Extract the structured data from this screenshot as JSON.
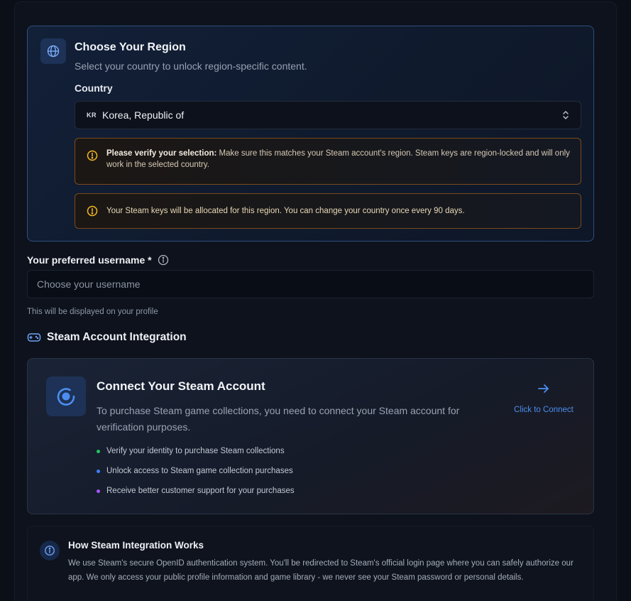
{
  "region": {
    "title": "Choose Your Region",
    "subtitle": "Select your country to unlock region-specific content.",
    "country_label": "Country",
    "selected_country_code": "KR",
    "selected_country_name": "Korea, Republic of",
    "warning_bold": "Please verify your selection:",
    "warning_text": " Make sure this matches your Steam account's region. Steam keys are region-locked and will only work in the selected country.",
    "notice_text": "Your Steam keys will be allocated for this region. You can change your country once every 90 days."
  },
  "username": {
    "label": "Your preferred username *",
    "placeholder": "Choose your username",
    "value": "",
    "help": "This will be displayed on your profile"
  },
  "steam": {
    "section_title": "Steam Account Integration",
    "connect_title": "Connect Your Steam Account",
    "connect_desc": "To purchase Steam game collections, you need to connect your Steam account for verification purposes.",
    "benefits": [
      {
        "text": "Verify your identity to purchase Steam collections",
        "color": "#22c55e"
      },
      {
        "text": "Unlock access to Steam game collection purchases",
        "color": "#3b82f6"
      },
      {
        "text": "Receive better customer support for your purchases",
        "color": "#a855f7"
      }
    ],
    "connect_action": "Click to Connect",
    "how_title": "How Steam Integration Works",
    "how_desc": "We use Steam's secure OpenID authentication system. You'll be redirected to Steam's official login page where you can safely authorize our app. We only access your public profile information and game library - we never see your Steam password or personal details."
  },
  "colors": {
    "accent": "#4c8ef0",
    "warning": "#f59e0b",
    "background": "#0b0f17"
  },
  "icons": {
    "region": "globe-icon",
    "select": "chevron-up-down-icon",
    "warning": "alert-circle-icon",
    "username_info": "info-icon",
    "steam_section": "gamepad-icon",
    "steam_badge": "steam-logo-icon",
    "connect": "arrow-right-icon",
    "how": "info-circle-icon"
  }
}
